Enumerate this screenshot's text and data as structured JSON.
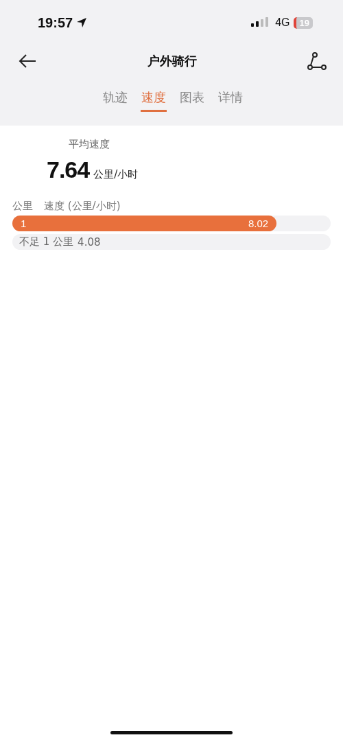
{
  "status_bar": {
    "time": "19:57",
    "network": "4G",
    "battery": "19"
  },
  "nav": {
    "title": "户外骑行"
  },
  "tabs": [
    {
      "label": "轨迹",
      "selected": false
    },
    {
      "label": "速度",
      "selected": true
    },
    {
      "label": "图表",
      "selected": false
    },
    {
      "label": "详情",
      "selected": false
    }
  ],
  "summary": {
    "label": "平均速度",
    "value": "7.64",
    "unit": "公里/小时"
  },
  "splits": {
    "columns": [
      "公里",
      "速度 (公里/小时)"
    ],
    "rows": [
      {
        "label": "1",
        "value": "8.02",
        "highlighted": true,
        "level": 0.83
      },
      {
        "label": "不足 1 公里",
        "value": "4.08",
        "highlighted": false
      }
    ]
  }
}
